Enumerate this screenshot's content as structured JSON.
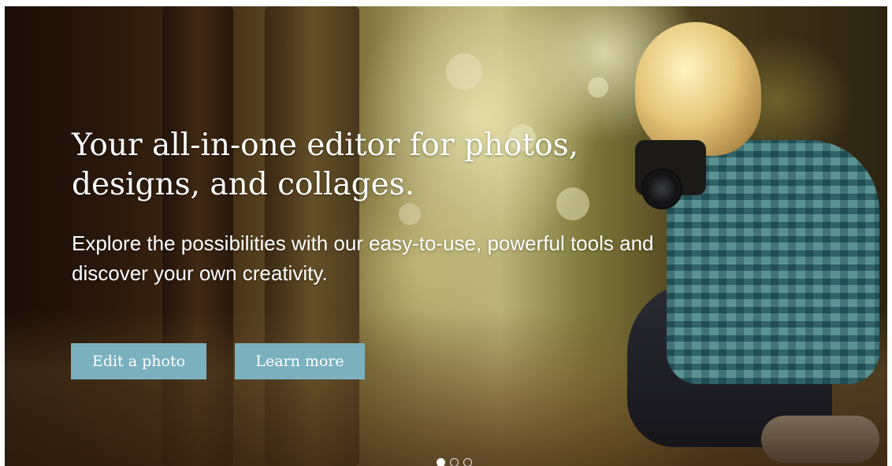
{
  "hero": {
    "headline": "Your all-in-one editor for photos, designs, and collages.",
    "subheadline": "Explore the possibilities with our easy-to-use, powerful tools and discover your own creativity.",
    "buttons": {
      "edit_photo": "Edit a photo",
      "learn_more": "Learn more"
    },
    "button_color": "#7bb1bf",
    "carousel": {
      "slide_count": 3,
      "active_index": 0
    }
  }
}
